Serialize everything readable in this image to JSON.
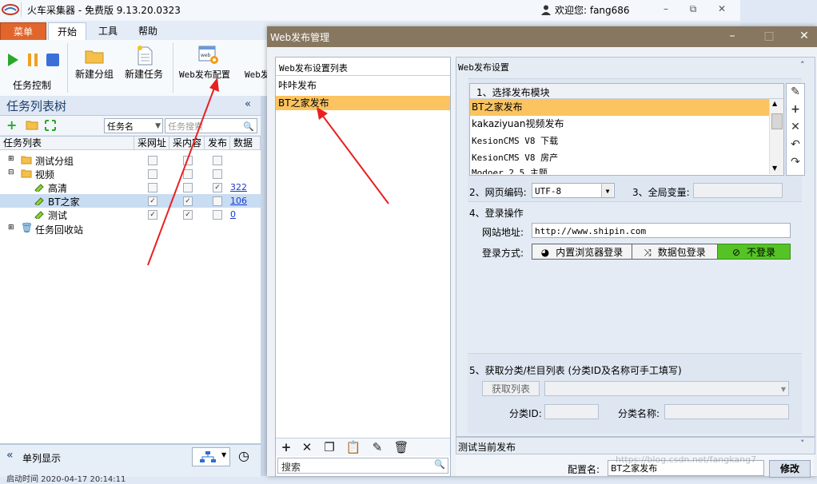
{
  "main": {
    "title": "火车采集器 - 免费版 9.13.20.0323",
    "welcome": "欢迎您: fang686",
    "tabs": [
      "菜单",
      "开始",
      "工具",
      "帮助"
    ],
    "ribbon": {
      "task_control_label": "任务控制",
      "new_group": "新建分组",
      "new_task": "新建任务",
      "web_publish_config": "Web发布配置",
      "web_cut": "Web发"
    },
    "task_panel": {
      "title": "任务列表树",
      "filter_select": "任务名",
      "search_placeholder": "任务搜索",
      "columns": [
        "任务列表",
        "采网址",
        "采内容",
        "发布",
        "数据"
      ],
      "rows": [
        {
          "label": "测试分组"
        },
        {
          "label": "视频"
        },
        {
          "label": "高清",
          "count": "322"
        },
        {
          "label": "BT之家",
          "count": "106"
        },
        {
          "label": "测试",
          "count": "0"
        },
        {
          "label": "任务回收站"
        }
      ],
      "footer_single": "单列显示",
      "footer_clip": "启动时间   2020-04-17 20:14:11"
    }
  },
  "dialog": {
    "title": "Web发布管理",
    "left": {
      "header": "Web发布设置列表",
      "items": [
        "咔咔发布",
        "BT之家发布"
      ],
      "search_placeholder": "搜索"
    },
    "settings": {
      "header": "Web发布设置",
      "module_header": "1、选择发布模块",
      "modules": [
        "BT之家发布",
        "kakaziyuan视频发布",
        "KesionCMS V8 下载",
        "KesionCMS V8 房产",
        "Modoer 2.5 主题"
      ],
      "encoding_label": "2、网页编码:",
      "encoding_value": "UTF-8",
      "global_var_label": "3、全局变量:",
      "login_header": "4、登录操作",
      "site_label": "网站地址:",
      "site_value": "http://www.shipin.com",
      "login_mode_label": "登录方式:",
      "login_buttons": [
        "内置浏览器登录",
        "数据包登录",
        "不登录"
      ],
      "category_header": "5、获取分类/栏目列表 (分类ID及名称可手工填写)",
      "get_list_button": "获取列表",
      "category_id_label": "分类ID:",
      "category_name_label": "分类名称:"
    },
    "test": {
      "header": "测试当前发布",
      "config_name_label": "配置名:",
      "config_name_value": "BT之家发布",
      "modify_button": "修改",
      "watermark": "https://blog.csdn.net/fangkang7"
    }
  },
  "colors": {
    "dialog_title_bg": "#877760",
    "selection": "#fbc460",
    "menu_tab": "#e0662c",
    "no_login_button": "#55c326",
    "arrow": "#e82020"
  }
}
